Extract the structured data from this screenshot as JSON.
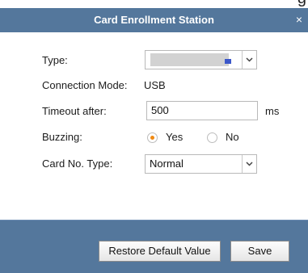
{
  "window": {
    "title": "Card Enrollment Station",
    "top_clipped_char": "g"
  },
  "form": {
    "type_label": "Type:",
    "connection_mode_label": "Connection Mode:",
    "connection_mode_value": "USB",
    "timeout_label": "Timeout after:",
    "timeout_value": "500",
    "timeout_unit": "ms",
    "buzzing_label": "Buzzing:",
    "buzzing_options": [
      {
        "label": "Yes",
        "checked": true
      },
      {
        "label": "No",
        "checked": false
      }
    ],
    "card_no_type_label": "Card No. Type:",
    "card_no_type_value": "Normal"
  },
  "footer": {
    "restore_label": "Restore Default Value",
    "save_label": "Save"
  },
  "colors": {
    "titlebar": "#54779c",
    "footer": "#54779c",
    "radio_selected": "#f08a14"
  },
  "icons": {
    "close": "close-icon",
    "dropdown": "chevron-down-icon"
  }
}
